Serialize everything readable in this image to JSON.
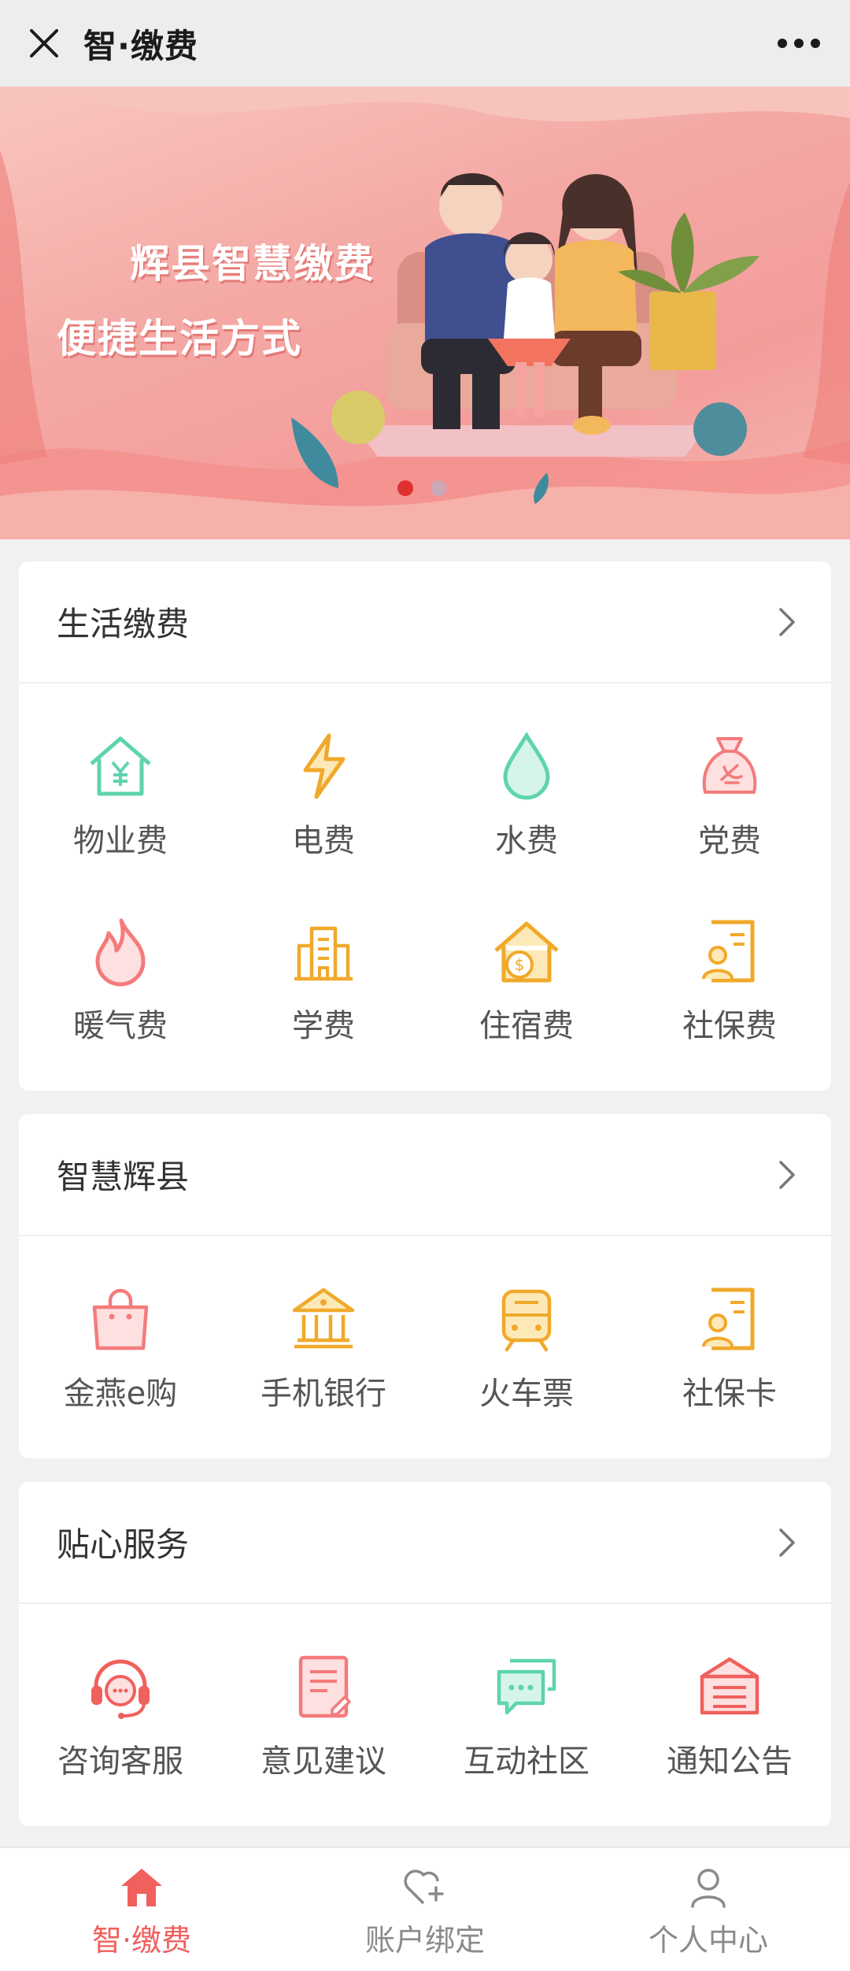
{
  "header": {
    "title": "智·缴费"
  },
  "banner": {
    "line1": "辉县智慧缴费",
    "line2": "便捷生活方式"
  },
  "sections": [
    {
      "title": "生活缴费",
      "items": [
        {
          "label": "物业费",
          "icon": "property-house-icon"
        },
        {
          "label": "电费",
          "icon": "lightning-icon"
        },
        {
          "label": "水费",
          "icon": "water-drop-icon"
        },
        {
          "label": "党费",
          "icon": "party-bag-icon"
        },
        {
          "label": "暖气费",
          "icon": "flame-icon"
        },
        {
          "label": "学费",
          "icon": "school-building-icon"
        },
        {
          "label": "住宿费",
          "icon": "house-coin-icon"
        },
        {
          "label": "社保费",
          "icon": "id-card-icon"
        }
      ]
    },
    {
      "title": "智慧辉县",
      "items": [
        {
          "label": "金燕e购",
          "icon": "shopping-bag-icon"
        },
        {
          "label": "手机银行",
          "icon": "bank-icon"
        },
        {
          "label": "火车票",
          "icon": "train-icon"
        },
        {
          "label": "社保卡",
          "icon": "id-card-icon"
        }
      ]
    },
    {
      "title": "贴心服务",
      "items": [
        {
          "label": "咨询客服",
          "icon": "headset-icon"
        },
        {
          "label": "意见建议",
          "icon": "document-edit-icon"
        },
        {
          "label": "互动社区",
          "icon": "chat-bubbles-icon"
        },
        {
          "label": "通知公告",
          "icon": "announcement-icon"
        }
      ]
    }
  ],
  "tabbar": {
    "tabs": [
      {
        "label": "智·缴费",
        "icon": "home-icon",
        "active": true
      },
      {
        "label": "账户绑定",
        "icon": "heart-plus-icon",
        "active": false
      },
      {
        "label": "个人中心",
        "icon": "user-icon",
        "active": false
      }
    ]
  },
  "colors": {
    "accent": "#f0605d",
    "mint": "#5fd3b0",
    "amber": "#f0a92a",
    "pink": "#f47b7b",
    "tab_inactive": "#8a8a8a"
  }
}
